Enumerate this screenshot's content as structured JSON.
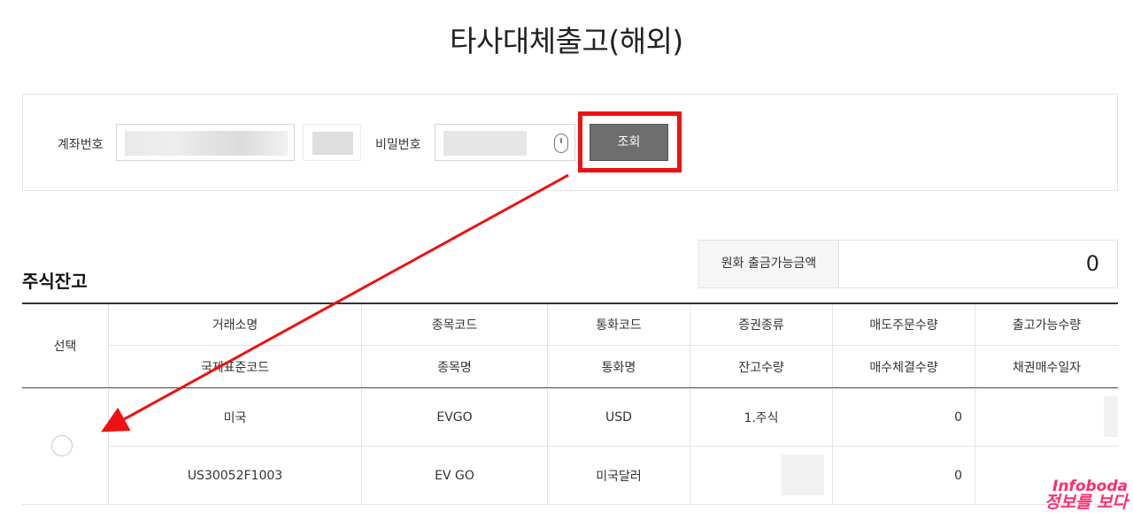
{
  "page": {
    "title": "타사대체출고(해외)"
  },
  "search": {
    "account_label": "계좌번호",
    "password_label": "비밀번호",
    "search_button": "조회"
  },
  "section": {
    "title": "주식잔고"
  },
  "available": {
    "label": "원화 출금가능금액",
    "value": "0"
  },
  "table": {
    "select_header": "선택",
    "header_row1": [
      "거래소명",
      "종목코드",
      "통화코드",
      "증권종류",
      "매도주문수량",
      "출고가능수량"
    ],
    "header_row2": [
      "국제표준코드",
      "종목명",
      "통화명",
      "잔고수량",
      "매수체결수량",
      "채권매수일자"
    ],
    "rows": [
      {
        "line1": [
          "미국",
          "EVGO",
          "USD",
          "1.주식",
          "0",
          ""
        ],
        "line2": [
          "US30052F1003",
          "EV GO",
          "미국달러",
          "",
          "0",
          ""
        ]
      }
    ]
  },
  "annotation": {
    "color": "#ee1111"
  },
  "watermark": {
    "line1": "Infoboda",
    "line2": "정보를 보다"
  }
}
